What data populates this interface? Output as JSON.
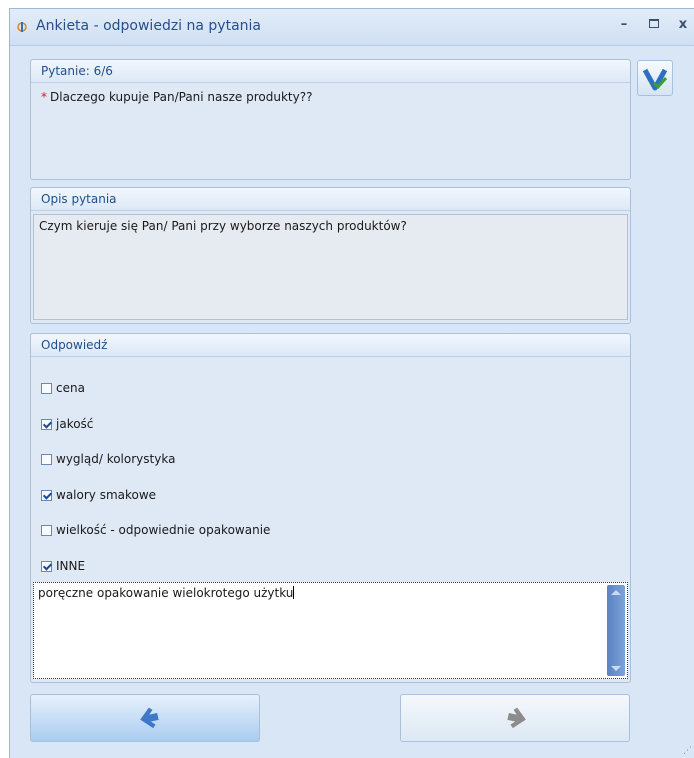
{
  "window": {
    "title": "Ankieta - odpowiedzi na pytania",
    "minimize_glyph": "–",
    "maximize_glyph": "▭",
    "close_glyph": "x"
  },
  "question": {
    "header": "Pytanie: 6/6",
    "required_mark": "*",
    "text": "Dlaczego kupuje Pan/Pani nasze produkty??"
  },
  "description": {
    "header": "Opis pytania",
    "text": "Czym kieruje się Pan/ Pani przy wyborze naszych produktów?"
  },
  "answer": {
    "header": "Odpowiedź",
    "options": [
      {
        "label": "cena",
        "checked": false
      },
      {
        "label": "jakość",
        "checked": true
      },
      {
        "label": "wygląd/ kolorystyka",
        "checked": false
      },
      {
        "label": "walory smakowe",
        "checked": true
      },
      {
        "label": "wielkość - odpowiednie opakowanie",
        "checked": false
      },
      {
        "label": "INNE",
        "checked": true
      }
    ],
    "other_text": "poręczne opakowanie wielokrotego użytku"
  },
  "buttons": {
    "previous": "previous-arrow-icon",
    "next": "next-arrow-icon",
    "save": "save-check-icon"
  },
  "colors": {
    "accent": "#27508a",
    "arrow_active": "#3f78c8",
    "arrow_disabled": "#8c8c8c"
  }
}
